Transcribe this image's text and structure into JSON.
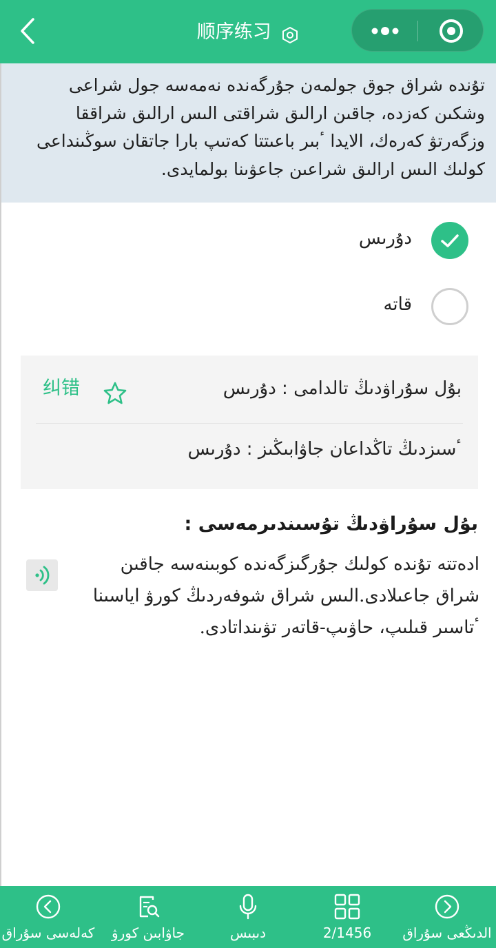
{
  "header": {
    "title": "顺序练习",
    "title_icon": "settings-hex-icon",
    "back_icon": "chevron-left-icon",
    "capsule_more_icon": "more-dots-icon",
    "capsule_close_icon": "target-circle-icon"
  },
  "question": {
    "text": "تۇندە شراق جوق جولمەن جۇرگەندە نەمەسە جول شراعى وشكىن كەزدە، جاقىن ارالىق شراقتى الىس ارالىق شراققا وزگەرتۋ كەرەك، الايدا ٴبىر باعىتتا كەتىپ بارا جاتقان سوڭىنداعى كولىك الىس ارالىق شراعىن جاعۋىنا بولمايدى."
  },
  "options": [
    {
      "label": "دۇرىس",
      "selected": true
    },
    {
      "label": "قاتە",
      "selected": false
    }
  ],
  "answer": {
    "correct_label": "بۇل سۇراۋدىڭ تالدامى :",
    "correct_value": "دۇرىس",
    "yours_label": "ٴسىزدىڭ تاڭداعان جاۋابىڭىز :",
    "yours_value": "دۇرىس",
    "report_label": "纠错",
    "favorite_icon": "star-outline-icon"
  },
  "explanation": {
    "title": "بۇل سۇراۋدىڭ تۇسىندىرمەسى :",
    "text": "ادەتتە تۇندە كولىك جۇرگىزگەندە كوبىنەسە جاقىن شراق جاعىلادى.الىس شراق شوفەردىڭ كورۋ اياسىنا ٴتاسىر قىلىپ، حاۋىپ-قاتەر تۋىنداتادى.",
    "audio_icon": "audio-wave-icon"
  },
  "bottom_nav": {
    "prev": {
      "label": "كەلەسى سۇراق",
      "icon": "chevron-left-circle-icon"
    },
    "answer": {
      "label": "جاۋابىن كورۋ",
      "icon": "document-search-icon"
    },
    "voice": {
      "label": "دىبىس",
      "icon": "microphone-icon"
    },
    "index": {
      "label": "2/1456",
      "icon": "grid-icon"
    },
    "next": {
      "label": "الدىڭعى سۇراق",
      "icon": "chevron-right-circle-icon"
    }
  },
  "colors": {
    "brand_green": "#2ec088",
    "question_bg": "#dfe8ef",
    "answer_bg": "#f4f4f4"
  }
}
